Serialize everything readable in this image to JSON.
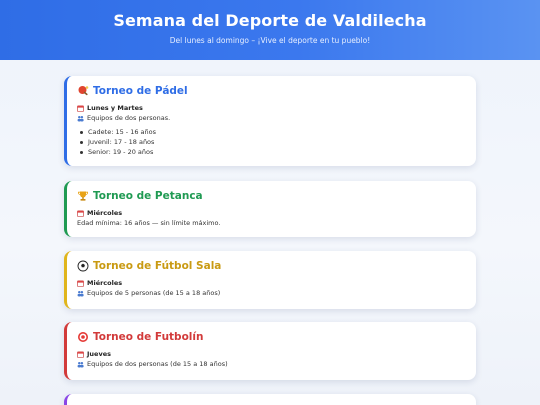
{
  "header": {
    "title": "Semana del Deporte de Valdilecha",
    "subtitle": "Del lunes al domingo – ¡Vive el deporte en tu pueblo!"
  },
  "colors": {
    "header_blue": "#2f6de6",
    "padel": "#2f6de6",
    "petanca": "#1f9a52",
    "futbol_sala": "#c99a12",
    "futbolin": "#d23a3a",
    "next": "#8a46e6"
  },
  "events": [
    {
      "icon": "ping-pong-icon",
      "title": "Torneo de Pádel",
      "day": "Lunes y Martes",
      "detail": "Equipos de dos personas.",
      "categories": [
        "Cadete: 15 - 16 años",
        "Juvenil: 17 - 18 años",
        "Senior: 19 - 20 años"
      ]
    },
    {
      "icon": "trophy-icon",
      "title": "Torneo de Petanca",
      "day": "Miércoles",
      "detail": "Edad mínima: 16 años — sin límite máximo."
    },
    {
      "icon": "soccer-ball-icon",
      "title": "Torneo de Fútbol Sala",
      "day": "Miércoles",
      "detail": "Equipos de 5 personas (de 15 a 18 años)"
    },
    {
      "icon": "target-icon",
      "title": "Torneo de Futbolín",
      "day": "Jueves",
      "detail": "Equipos de dos personas (de 15 a 18 años)"
    }
  ]
}
